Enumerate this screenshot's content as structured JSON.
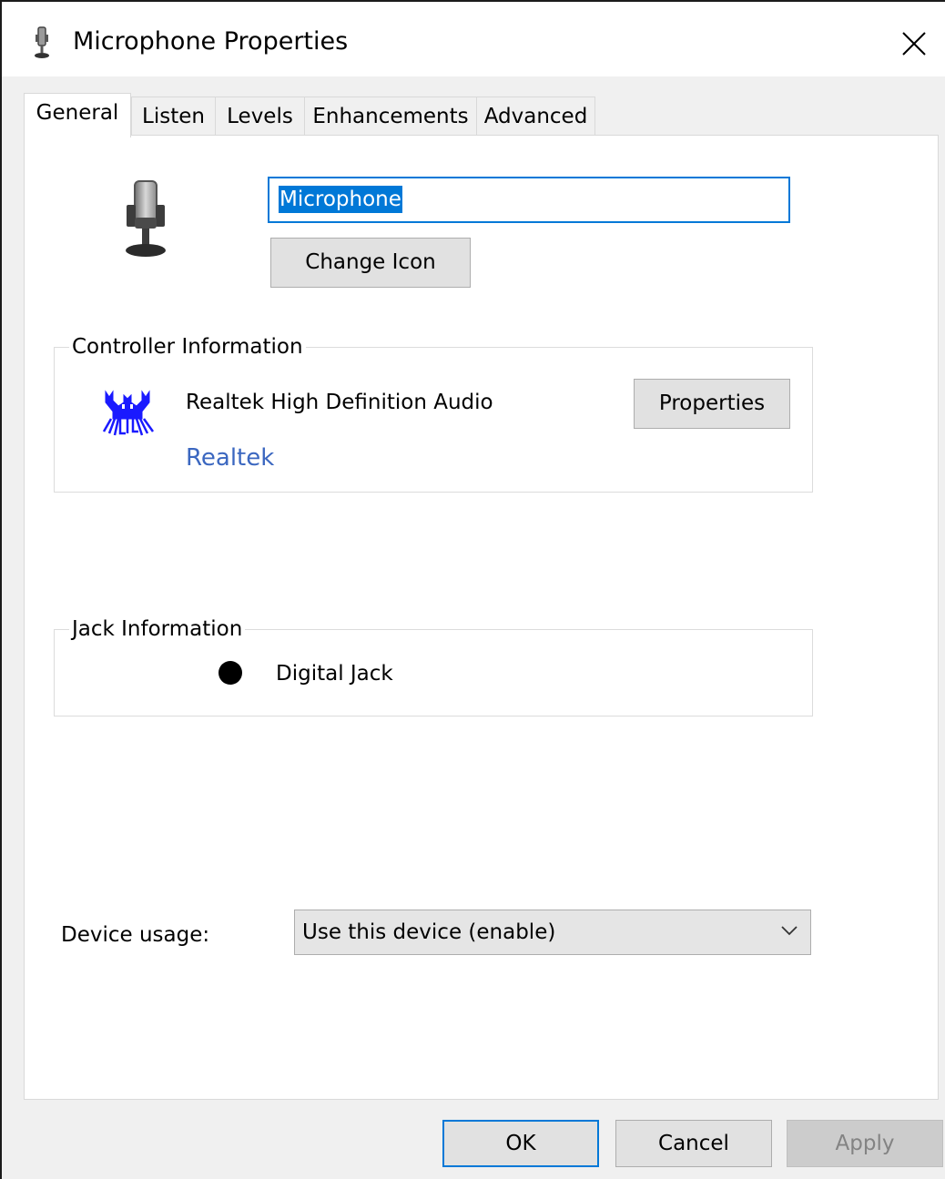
{
  "window": {
    "title": "Microphone Properties",
    "title_icon": "microphone-icon",
    "close_icon": "close-icon"
  },
  "tabs": [
    {
      "label": "General",
      "active": true
    },
    {
      "label": "Listen",
      "active": false
    },
    {
      "label": "Levels",
      "active": false
    },
    {
      "label": "Enhancements",
      "active": false
    },
    {
      "label": "Advanced",
      "active": false
    }
  ],
  "general": {
    "device_icon": "microphone-icon",
    "device_name": "Microphone",
    "change_icon_label": "Change Icon",
    "controller": {
      "group_label": "Controller Information",
      "logo": "realtek-logo",
      "name": "Realtek High Definition Audio",
      "vendor_link": "Realtek",
      "properties_label": "Properties"
    },
    "jack": {
      "group_label": "Jack Information",
      "label": "Digital Jack"
    },
    "device_usage": {
      "label": "Device usage:",
      "value": "Use this device (enable)"
    }
  },
  "footer": {
    "ok": "OK",
    "cancel": "Cancel",
    "apply": "Apply",
    "apply_enabled": false
  },
  "colors": {
    "accent": "#0078d7",
    "link": "#3b67c0",
    "realtek_blue": "#1a1aff"
  }
}
